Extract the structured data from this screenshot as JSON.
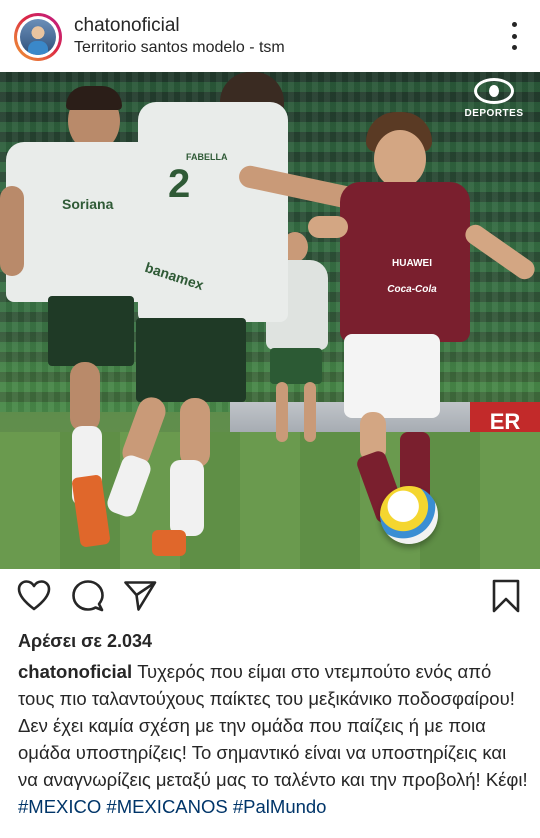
{
  "post": {
    "username": "chatonoficial",
    "location": "Territorio santos modelo - tsm",
    "photo": {
      "broadcaster_logo": "DEPORTES",
      "player_left_number": "2",
      "player_left_name": "FABELLA",
      "player_left_sponsor": "Soriana",
      "player_left_sponsor2": "banamex",
      "player_right_sponsor": "HUAWEI",
      "player_right_sponsor2": "Coca-Cola",
      "adboard_text": "ER"
    },
    "likes_text": "Αρέσει σε 2.034",
    "caption": {
      "username": "chatonoficial",
      "text": " Τυχερός που είμαι στο ντεμπούτο ενός από τους πιο ταλαντούχους παίκτες του μεξικάνικο ποδοσφαίρου! Δεν έχει καμία σχέση με την ομάδα που παίζεις ή με ποια ομάδα υποστηρίζεις! Το σημαντικό είναι να υποστηρίζεις και να αναγνωρίζεις μεταξύ μας το ταλέντο και την προβολή! Κέφι! ",
      "hashtags": [
        "#MEXICO",
        "#MEXICANOS",
        "#PalMundo"
      ]
    },
    "icons": {
      "more": "more-options-icon",
      "like": "heart-icon",
      "comment": "comment-icon",
      "share": "send-icon",
      "save": "bookmark-icon"
    }
  }
}
